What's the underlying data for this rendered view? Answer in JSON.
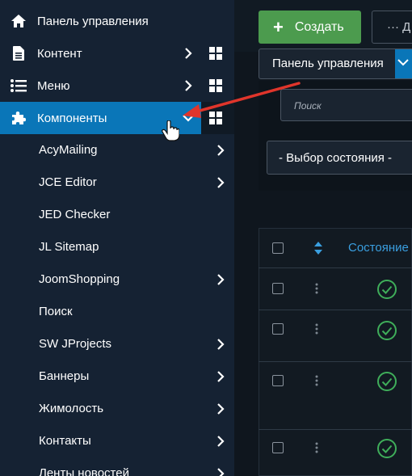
{
  "sidebar": {
    "top_items": [
      {
        "label": "Панель управления",
        "icon": "home-icon"
      },
      {
        "label": "Контент",
        "icon": "file-icon"
      },
      {
        "label": "Меню",
        "icon": "list-icon"
      },
      {
        "label": "Компоненты",
        "icon": "puzzle-icon"
      }
    ],
    "components": [
      {
        "label": "AcyMailing"
      },
      {
        "label": "JCE Editor"
      },
      {
        "label": "JED Checker"
      },
      {
        "label": "JL Sitemap"
      },
      {
        "label": "JoomShopping"
      },
      {
        "label": "Поиск"
      },
      {
        "label": "SW JProjects"
      },
      {
        "label": "Баннеры"
      },
      {
        "label": "Жимолость"
      },
      {
        "label": "Контакты"
      },
      {
        "label": "Ленты новостей"
      }
    ]
  },
  "toolbar": {
    "create_label": "Создать",
    "more_label": "··· Д"
  },
  "filters": {
    "panel_select_value": "Панель управления",
    "search_placeholder": "Поиск",
    "state_select_value": "- Выбор состояния -"
  },
  "table": {
    "column_state": "Состояние"
  },
  "colors": {
    "active": "#0a76b8",
    "create_green": "#4c9b4e",
    "link_blue": "#3a9fe0",
    "check_green": "#3fae5a",
    "annotation_red": "#e0352b"
  }
}
